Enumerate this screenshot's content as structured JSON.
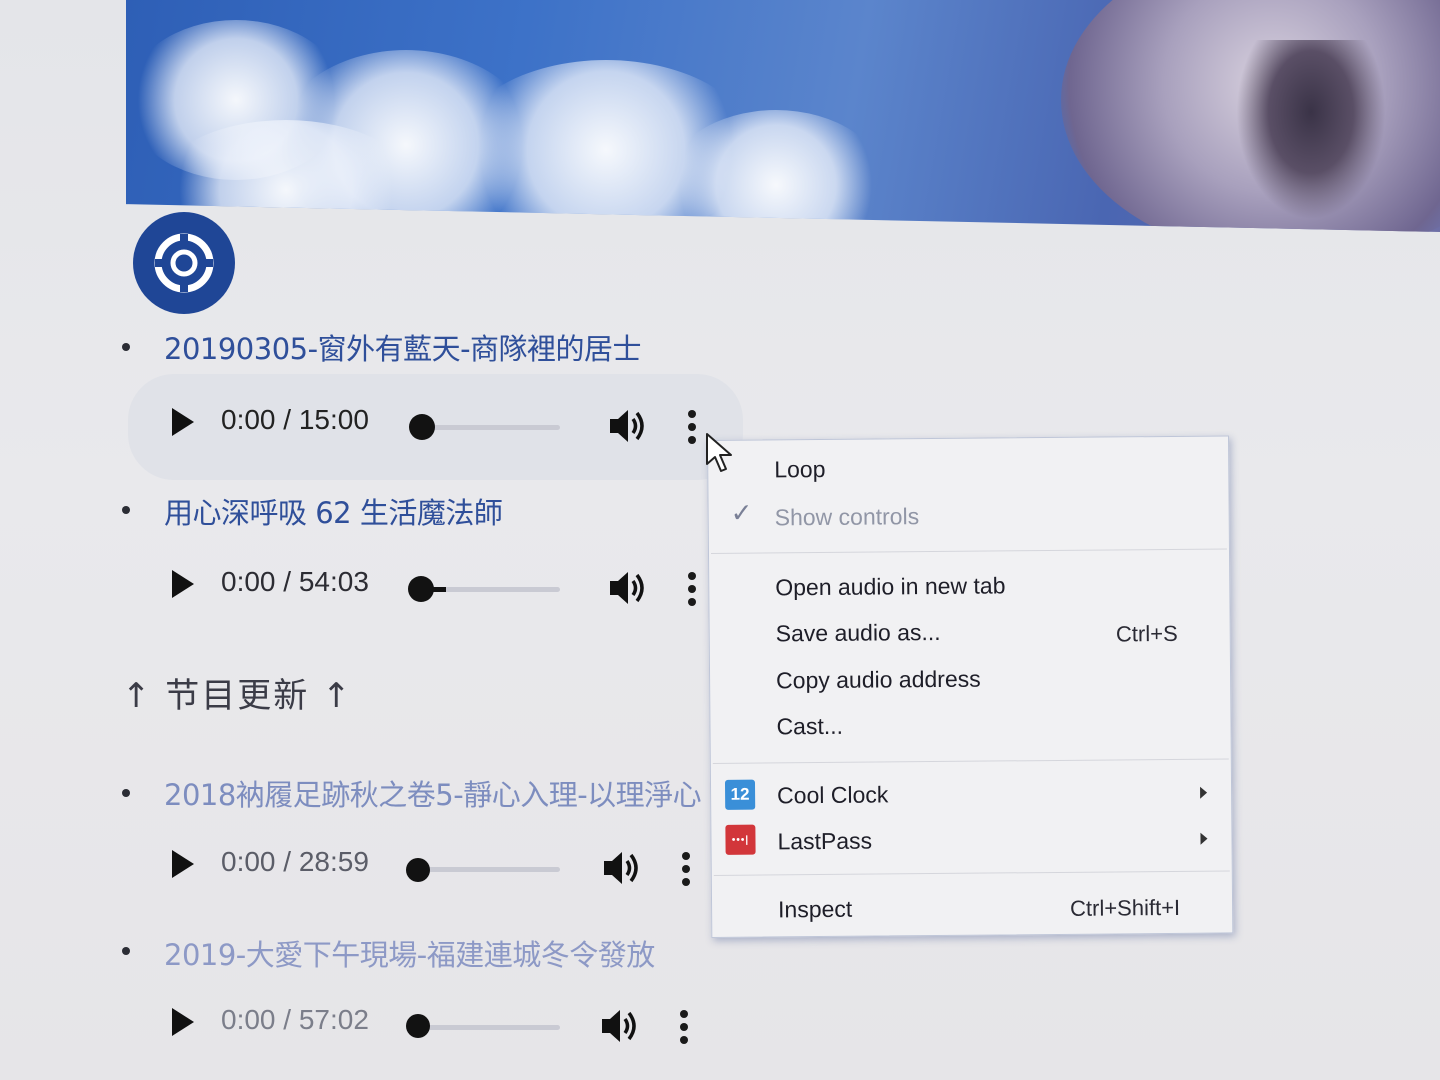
{
  "tracks": [
    {
      "title": "20190305-窗外有藍天-商隊裡的居士",
      "time": "0:00 / 15:00"
    },
    {
      "title": "用心深呼吸 62 生活魔法師",
      "time": "0:00 / 54:03"
    },
    {
      "title": "2018衲履足跡秋之卷5-靜心入理-以理淨心",
      "time": "0:00 / 28:59"
    },
    {
      "title": "2019-大愛下午現場-福建連城冬令發放",
      "time": "0:00 / 57:02"
    }
  ],
  "section_heading": "↑ 节目更新 ↑",
  "context_menu": {
    "loop": "Loop",
    "show_controls": "Show controls",
    "open_new_tab": "Open audio in new tab",
    "save_as": "Save audio as...",
    "save_shortcut": "Ctrl+S",
    "copy_address": "Copy audio address",
    "cast": "Cast...",
    "cool_clock": "Cool Clock",
    "cool_clock_icon_text": "12",
    "lastpass": "LastPass",
    "inspect": "Inspect",
    "inspect_shortcut": "Ctrl+Shift+I"
  },
  "icons": {
    "logo": "lifebuoy-logo-icon",
    "play": "play-icon",
    "volume": "volume-icon",
    "more": "more-vertical-icon",
    "check": "checkmark-icon",
    "submenu": "submenu-arrow-icon",
    "cursor": "mouse-pointer-icon"
  },
  "colors": {
    "logo_bg": "#1f4696",
    "link": "#2f4f9a",
    "cool_clock": "#3a8fd8",
    "lastpass": "#d2363a"
  }
}
